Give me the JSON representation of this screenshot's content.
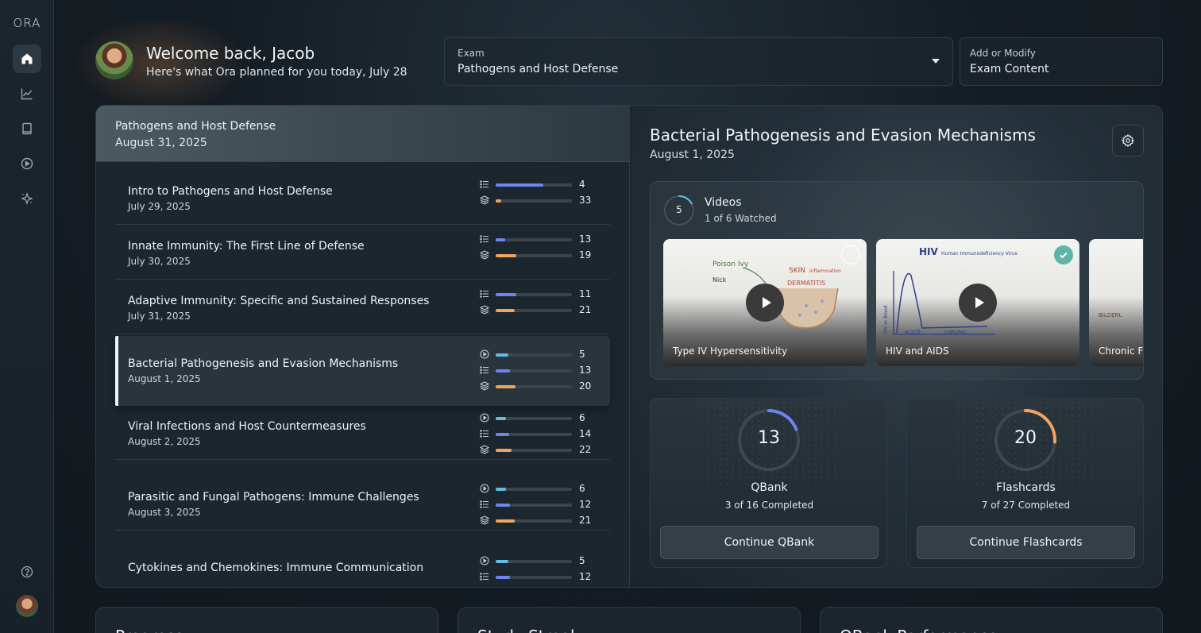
{
  "app": {
    "logo": "ORA"
  },
  "header": {
    "welcome": "Welcome back, Jacob",
    "subtitle": "Here's what Ora planned for you today, July 28",
    "exam_label": "Exam",
    "exam_value": "Pathogens and Host Defense",
    "add_label": "Add or Modify",
    "add_value": "Exam Content"
  },
  "sidebar": {
    "items": [
      {
        "name": "home-icon",
        "active": true
      },
      {
        "name": "chart-icon",
        "active": false
      },
      {
        "name": "book-icon",
        "active": false
      },
      {
        "name": "play-icon",
        "active": false
      },
      {
        "name": "sparkle-icon",
        "active": false
      }
    ],
    "help": "help-icon"
  },
  "exam_panel": {
    "title": "Pathogens and Host Defense",
    "date": "August 31, 2025",
    "topics": [
      {
        "title": "Intro to Pathogens and Host Defense",
        "date": "July 29, 2025",
        "stats": [
          {
            "icon": "list-icon",
            "value": "4",
            "progress": 0.63,
            "color": "#6c86f0"
          },
          {
            "icon": "layers-icon",
            "value": "33",
            "progress": 0.07,
            "color": "#f0a45c"
          }
        ]
      },
      {
        "title": "Innate Immunity: The First Line of Defense",
        "date": "July 30, 2025",
        "stats": [
          {
            "icon": "list-icon",
            "value": "13",
            "progress": 0.12,
            "color": "#6c86f0"
          },
          {
            "icon": "layers-icon",
            "value": "19",
            "progress": 0.27,
            "color": "#f0a45c"
          }
        ]
      },
      {
        "title": "Adaptive Immunity: Specific and Sustained Responses",
        "date": "July 31, 2025",
        "stats": [
          {
            "icon": "list-icon",
            "value": "11",
            "progress": 0.27,
            "color": "#6c86f0"
          },
          {
            "icon": "layers-icon",
            "value": "21",
            "progress": 0.25,
            "color": "#f0a45c"
          }
        ]
      },
      {
        "title": "Bacterial Pathogenesis and Evasion Mechanisms",
        "date": "August 1, 2025",
        "selected": true,
        "stats": [
          {
            "icon": "play-circle-icon",
            "value": "5",
            "progress": 0.17,
            "color": "#62bde6"
          },
          {
            "icon": "list-icon",
            "value": "13",
            "progress": 0.19,
            "color": "#6c86f0"
          },
          {
            "icon": "layers-icon",
            "value": "20",
            "progress": 0.26,
            "color": "#f0a45c"
          }
        ]
      },
      {
        "title": "Viral Infections and Host Countermeasures",
        "date": "August 2, 2025",
        "stats": [
          {
            "icon": "play-circle-icon",
            "value": "6",
            "progress": 0.14,
            "color": "#62bde6"
          },
          {
            "icon": "list-icon",
            "value": "14",
            "progress": 0.18,
            "color": "#6c86f0"
          },
          {
            "icon": "layers-icon",
            "value": "22",
            "progress": 0.21,
            "color": "#f0a45c"
          }
        ]
      },
      {
        "title": "Parasitic and Fungal Pathogens: Immune Challenges",
        "date": "August 3, 2025",
        "stats": [
          {
            "icon": "play-circle-icon",
            "value": "6",
            "progress": 0.14,
            "color": "#62bde6"
          },
          {
            "icon": "list-icon",
            "value": "12",
            "progress": 0.19,
            "color": "#6c86f0"
          },
          {
            "icon": "layers-icon",
            "value": "21",
            "progress": 0.25,
            "color": "#f0a45c"
          }
        ]
      },
      {
        "title": "Cytokines and Chemokines: Immune Communication",
        "date": "",
        "stats": [
          {
            "icon": "play-circle-icon",
            "value": "5",
            "progress": 0.17,
            "color": "#62bde6"
          },
          {
            "icon": "list-icon",
            "value": "12",
            "progress": 0.19,
            "color": "#6c86f0"
          }
        ]
      }
    ]
  },
  "detail": {
    "title": "Bacterial Pathogenesis and Evasion Mechanisms",
    "date": "August 1, 2025",
    "videos": {
      "count": "5",
      "heading": "Videos",
      "subtitle": "1 of 6 Watched",
      "progress": 0.17,
      "items": [
        {
          "caption": "Type IV Hypersensitivity",
          "watched": false,
          "sketch": [
            "Poison Ivy",
            "Nick",
            "SKIN",
            "DERMATITIS",
            "inflammation"
          ]
        },
        {
          "caption": "HIV and AIDS",
          "watched": true,
          "sketch": [
            "HIV",
            "Human Immunodeficiency Virus",
            "HIV in Blood",
            "ACUTE",
            "CHRONIC"
          ]
        },
        {
          "caption": "Chronic F",
          "watched": false,
          "sketch": [
            "BILDERL"
          ]
        }
      ]
    },
    "qbank": {
      "value": "13",
      "label": "QBank",
      "sub": "3 of 16 Completed",
      "button": "Continue QBank",
      "progress": 0.19,
      "color": "#6c86f0"
    },
    "flashcards": {
      "value": "20",
      "label": "Flashcards",
      "sub": "7 of 27 Completed",
      "button": "Continue Flashcards",
      "progress": 0.26,
      "color": "#f0a45c"
    }
  },
  "bottom_cards": [
    {
      "title": "Progress"
    },
    {
      "title": "Study Streak"
    },
    {
      "title": "QBank Performance"
    }
  ]
}
